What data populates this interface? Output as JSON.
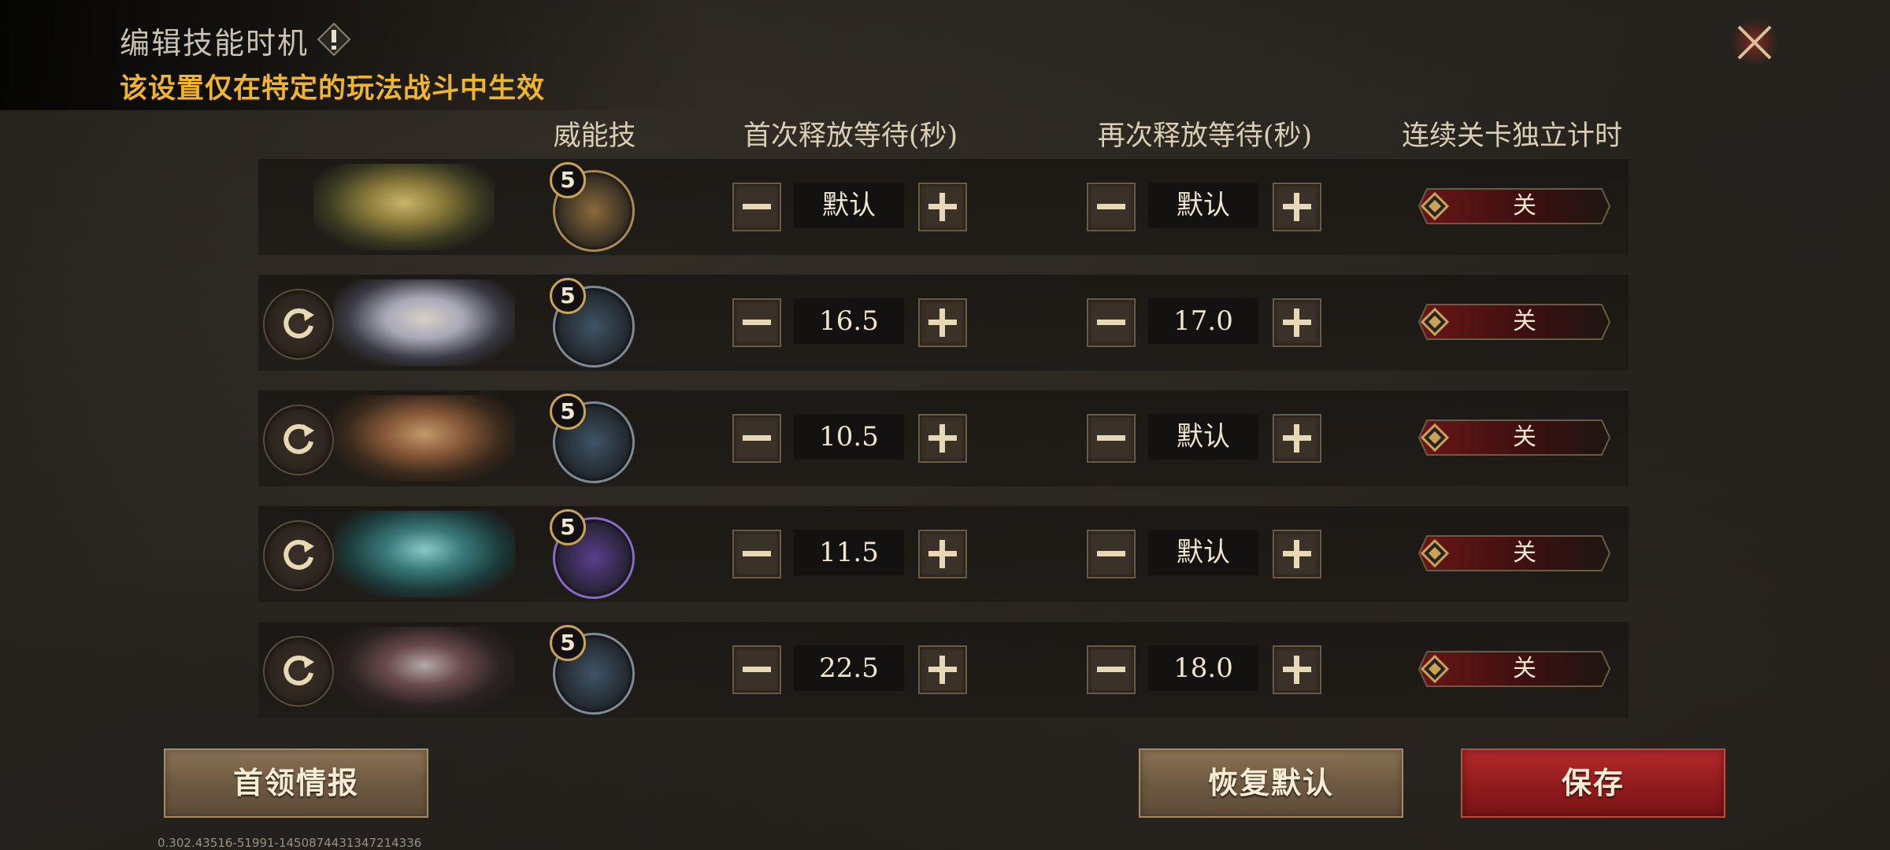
{
  "header": {
    "title": "编辑技能时机",
    "warning_icon": "exclamation-diamond-icon",
    "subtitle": "该设置仅在特定的玩法战斗中生效",
    "close_icon": "close-x-icon"
  },
  "columns": {
    "skill": "威能技",
    "first_wait": "首次释放等待(秒)",
    "next_wait": "再次释放等待(秒)",
    "independent_timer": "连续关卡独立计时"
  },
  "rows": [
    {
      "hero": "hero-portrait-gold-armored",
      "has_refresh": false,
      "skill_level": "5",
      "skill_color": "#8a6a3a",
      "first_wait": "默认",
      "next_wait": "默认",
      "toggle": "关"
    },
    {
      "hero": "hero-portrait-white-haired",
      "has_refresh": true,
      "skill_level": "5",
      "skill_color": "#3e5466",
      "first_wait": "16.5",
      "next_wait": "17.0",
      "toggle": "关"
    },
    {
      "hero": "hero-portrait-bearded-warrior",
      "has_refresh": true,
      "skill_level": "5",
      "skill_color": "#3e5466",
      "first_wait": "10.5",
      "next_wait": "默认",
      "toggle": "关"
    },
    {
      "hero": "hero-portrait-teal-demon",
      "has_refresh": true,
      "skill_level": "5",
      "skill_color": "#5a3e8c",
      "first_wait": "11.5",
      "next_wait": "默认",
      "toggle": "关"
    },
    {
      "hero": "hero-portrait-horned-beast",
      "has_refresh": true,
      "skill_level": "5",
      "skill_color": "#3e5466",
      "first_wait": "22.5",
      "next_wait": "18.0",
      "toggle": "关"
    }
  ],
  "footer": {
    "boss_info": "首领情报",
    "restore_default": "恢复默认",
    "save": "保存",
    "version": "0.302.43516-51991-1450874431347214336"
  },
  "colors": {
    "accent_gold": "#f1b52c",
    "save_red": "#9e1f22",
    "toggle_red": "#5a1414"
  }
}
